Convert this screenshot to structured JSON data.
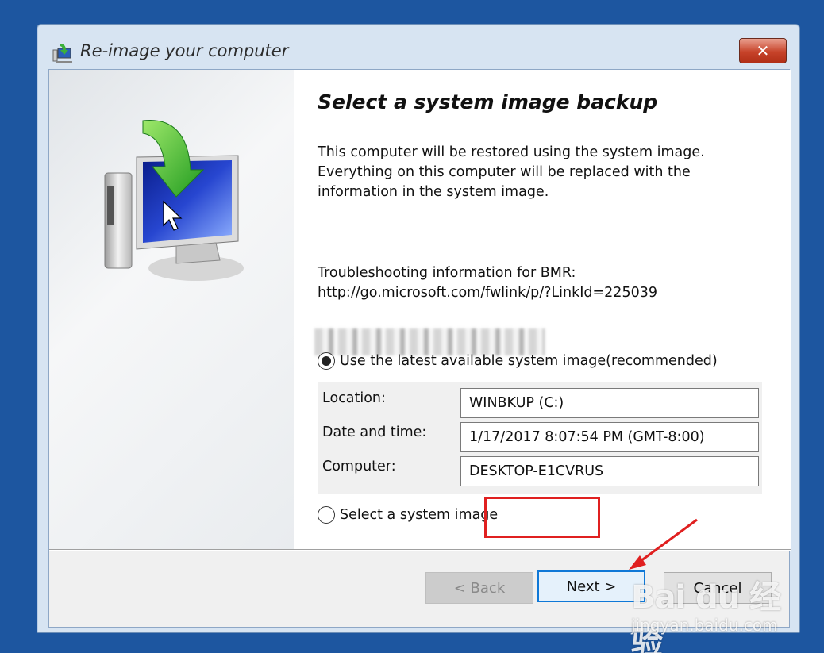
{
  "window": {
    "title": "Re-image your computer",
    "close_label": "✕"
  },
  "content": {
    "heading": "Select a system image backup",
    "description": [
      "This computer will be restored using the system image.",
      "Everything on this computer will be replaced with the",
      "information in the system image."
    ],
    "troubleshoot_line1": "Troubleshooting information for BMR:",
    "troubleshoot_line2": "http://go.microsoft.com/fwlink/p/?LinkId=225039",
    "option_latest": "Use the latest available system image(recommended)",
    "option_select": "Select a system image",
    "selected_option": "latest",
    "fields": {
      "location_label": "Location:",
      "location_value": "WINBKUP (C:)",
      "datetime_label": "Date and time:",
      "datetime_value": "1/17/2017 8:07:54 PM (GMT-8:00)",
      "computer_label": "Computer:",
      "computer_value": "DESKTOP-E1CVRUS"
    }
  },
  "buttons": {
    "back": "< Back",
    "next": "Next >",
    "cancel": "Cancel"
  },
  "watermark": {
    "logo": "Bai du 经验",
    "site": "jingyan.baidu.com"
  },
  "colors": {
    "desktop": "#1d56a0",
    "annotation": "#e02020",
    "focus": "#0f78d7"
  }
}
